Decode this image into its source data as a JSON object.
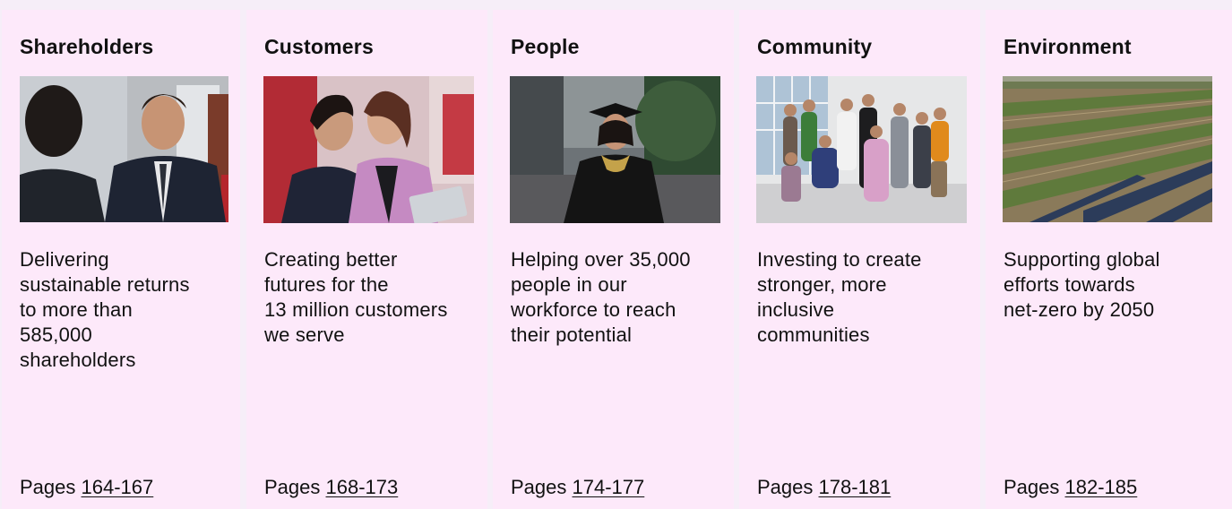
{
  "cards": [
    {
      "title": "Shareholders",
      "photo_icon": "image-icon",
      "description": "Delivering\nsustainable returns\nto more than\n585,000\nshareholders",
      "pages_label": "Pages",
      "pages_link": "164-167"
    },
    {
      "title": "Customers",
      "photo_icon": "image-icon",
      "description": "Creating better\nfutures for the\n13 million customers\nwe serve",
      "pages_label": "Pages",
      "pages_link": "168-173"
    },
    {
      "title": "People",
      "photo_icon": "image-icon",
      "description": "Helping over 35,000\npeople in our\nworkforce to reach\ntheir potential",
      "pages_label": "Pages",
      "pages_link": "174-177"
    },
    {
      "title": "Community",
      "photo_icon": "image-icon",
      "description": "Investing to create\nstronger, more\ninclusive\ncommunities",
      "pages_label": "Pages",
      "pages_link": "178-181"
    },
    {
      "title": "Environment",
      "photo_icon": "image-icon",
      "description": "Supporting global\nefforts towards\nnet-zero by 2050",
      "pages_label": "Pages",
      "pages_link": "182-185"
    }
  ],
  "colors": {
    "card_background": "#fde9fa",
    "page_background": "#f6eef8",
    "text": "#111111"
  }
}
